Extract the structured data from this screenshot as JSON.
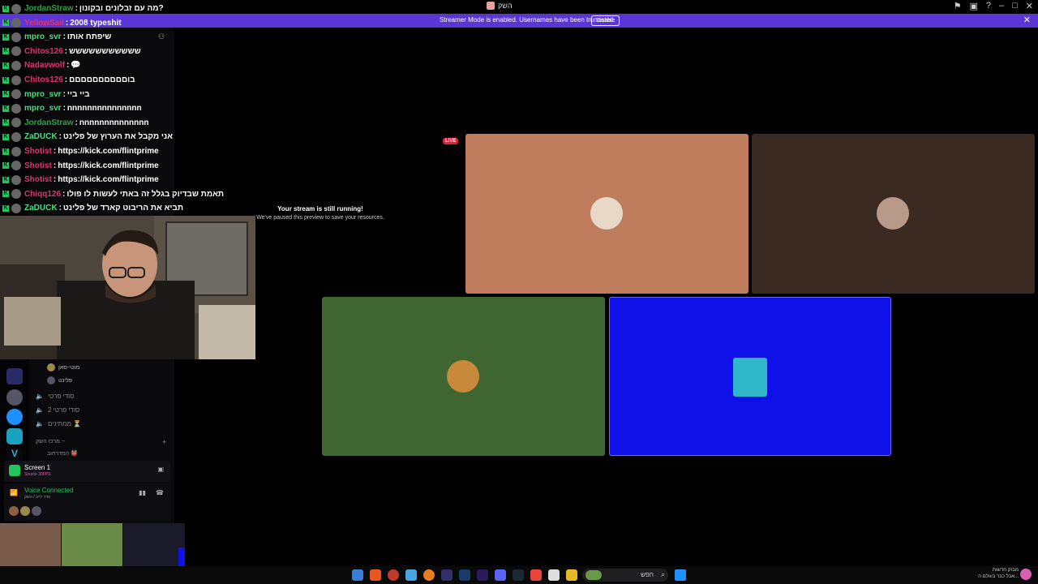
{
  "window": {
    "title": "השק"
  },
  "banner": {
    "text": "Streamer Mode is enabled. Usernames have been truncated.",
    "button": "Disable",
    "color": "#5a36d6"
  },
  "chat": [
    {
      "user": "JordanStraw",
      "sep": " : ",
      "msg": "מה עם זבלונים ובקונון?",
      "color": "#2ea043"
    },
    {
      "user": "YellowSail",
      "sep": " : ",
      "msg": "2008 typeshit",
      "color": "#e0306e"
    },
    {
      "user": "mpro_svr",
      "sep": " : ",
      "msg": "שיפתח אותו",
      "color": "#4ade80"
    },
    {
      "user": "Chitos126",
      "sep": " : ",
      "msg": "ששששששששששש",
      "color": "#e0306e"
    },
    {
      "user": "Nadavwolf",
      "sep": " : ",
      "msg": "💬",
      "color": "#e0306e"
    },
    {
      "user": "Chitos126",
      "sep": " : ",
      "msg": "בוםםםםםםםםםם",
      "color": "#e0306e"
    },
    {
      "user": "mpro_svr",
      "sep": " : ",
      "msg": "ביי ביי",
      "color": "#4ade80"
    },
    {
      "user": "mpro_svr",
      "sep": " : ",
      "msg": "nnnnnnnnnnnnnnn",
      "color": "#4ade80"
    },
    {
      "user": "JordanStraw",
      "sep": " : ",
      "msg": "nnnnnnnnnnnnnn",
      "color": "#2ea043"
    },
    {
      "user": "ZaDUCK",
      "sep": " : ",
      "msg": "אני מקבל את הערוץ של פלינט",
      "color": "#4ade80"
    },
    {
      "user": "Shotist",
      "sep": " : ",
      "msg": "https://kick.com/flintprime",
      "color": "#e0306e"
    },
    {
      "user": "Shotist",
      "sep": " : ",
      "msg": "https://kick.com/flintprime",
      "color": "#e0306e"
    },
    {
      "user": "Shotist",
      "sep": " : ",
      "msg": "https://kick.com/flintprime",
      "color": "#e0306e"
    },
    {
      "user": "Chiqq126",
      "sep": " : ",
      "msg": "תאמת שבדיוק בגלל זה באתי לעשות לו פולו",
      "color": "#e0306e"
    },
    {
      "user": "ZaDUCK",
      "sep": " : ",
      "msg": "תביא את הריבוט קארד של פלינט",
      "color": "#4ade80"
    }
  ],
  "chat_badge": "K",
  "sidebar": {
    "voice_users": [
      "מוטי-סאן",
      "פלינט"
    ],
    "channels": [
      {
        "label": "סודי פרטי",
        "icon": "speaker-icon"
      },
      {
        "label": "סודי פרטי 2",
        "icon": "speaker-icon"
      },
      {
        "label": "ממתינים ⏳",
        "icon": "speaker-icon"
      }
    ],
    "category": "מרכז השק ~",
    "sub_channel": "המדרחוב 👹",
    "screen_panel": {
      "title": "Screen 1",
      "sub": "Source 30FPS"
    },
    "voice_panel": {
      "status": "Voice Connected",
      "sub": "חדר לייב / השק"
    }
  },
  "stage": {
    "paused_title": "Your stream is still running!",
    "paused_sub": "We've paused this preview to save your resources.",
    "live": "LIVE",
    "tiles": [
      {
        "name": "tile-user-1",
        "color": "#c07d5d"
      },
      {
        "name": "tile-user-2",
        "color": "#3a2a22"
      },
      {
        "name": "tile-user-3",
        "color": "#3f6531"
      },
      {
        "name": "tile-user-4",
        "color": "#1010e8"
      }
    ]
  },
  "taskbar": {
    "search_placeholder": "חפש",
    "notify_title": "מבזק חדשות",
    "notify_sub": "אבל כבר בעולם ה..."
  }
}
